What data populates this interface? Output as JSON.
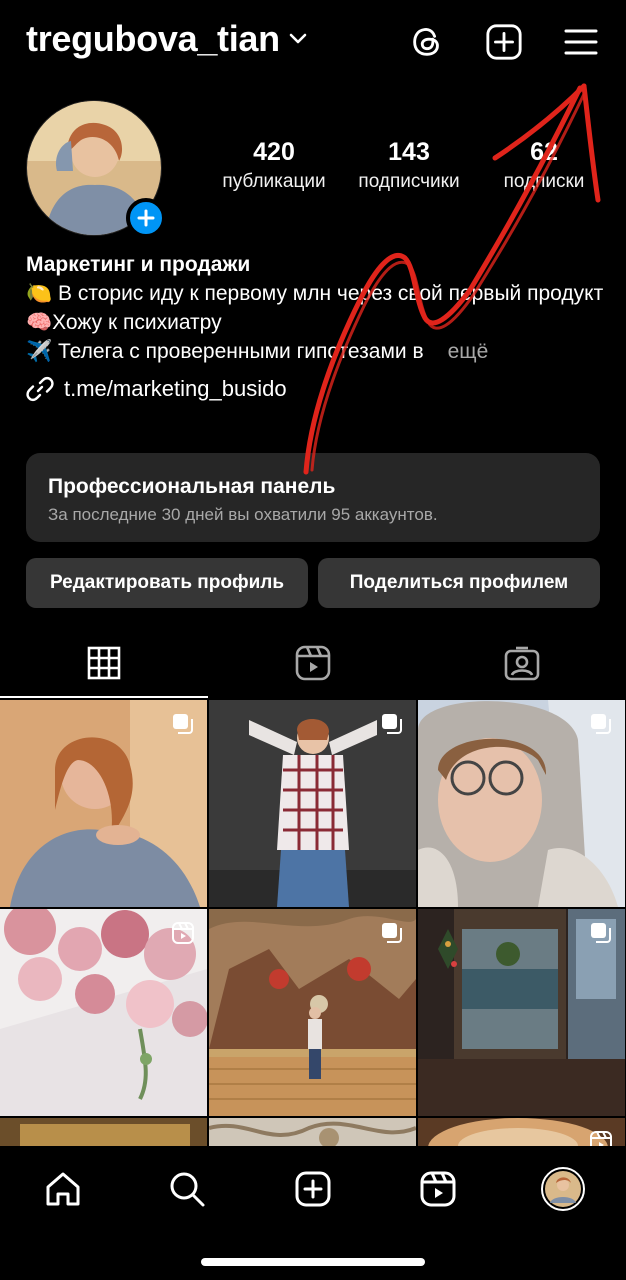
{
  "header": {
    "username": "tregubova_tian",
    "dropdown_icon": "chevron-down-icon",
    "threads_icon": "threads-icon",
    "create_icon": "plus-square-icon",
    "menu_icon": "hamburger-menu-icon"
  },
  "profile": {
    "avatar_icon": "add-story-plus-icon",
    "stats": [
      {
        "value": "420",
        "label": "публикации"
      },
      {
        "value": "143",
        "label": "подписчики"
      },
      {
        "value": "62",
        "label": "подписки"
      }
    ],
    "bio": {
      "name": "Маркетинг и продажи",
      "line1": "🍋 В сторис иду к первому млн через свой первый продукт",
      "line2": "🧠Хожу к психиатру",
      "line3": "✈️ Телега с проверенными гипотезами в",
      "more": "ещё",
      "link": "t.me/marketing_busido"
    }
  },
  "pro_panel": {
    "title": "Профессиональная панель",
    "subtitle": "За последние 30 дней вы охватили 95 аккаунтов."
  },
  "buttons": {
    "edit": "Редактировать профиль",
    "share": "Поделиться профилем"
  },
  "tabs": [
    "grid-icon",
    "reels-icon",
    "tagged-icon"
  ],
  "grid_posts": [
    {
      "type": "carousel",
      "desc": "portrait-woman-silk-shirt"
    },
    {
      "type": "carousel",
      "desc": "woman-plaid-shirt-dark-backdrop"
    },
    {
      "type": "carousel",
      "desc": "selfie-snow-hood"
    },
    {
      "type": "reel",
      "desc": "pink-roses"
    },
    {
      "type": "carousel",
      "desc": "museum-painting-hall"
    },
    {
      "type": "carousel",
      "desc": "cafe-mirror-window"
    },
    {
      "type": "none",
      "desc": "gold-frame"
    },
    {
      "type": "none",
      "desc": "ornate-ceiling"
    },
    {
      "type": "reel",
      "desc": "coffee-cup"
    }
  ],
  "bottom_nav": [
    "home-icon",
    "search-icon",
    "create-icon",
    "reels-icon",
    "profile-avatar"
  ],
  "colors": {
    "background": "#000000",
    "panel": "#262626",
    "button": "#363636",
    "accent_blue": "#0095f6",
    "secondary_text": "#a8a8a8",
    "annotation_red": "#e0241b"
  }
}
